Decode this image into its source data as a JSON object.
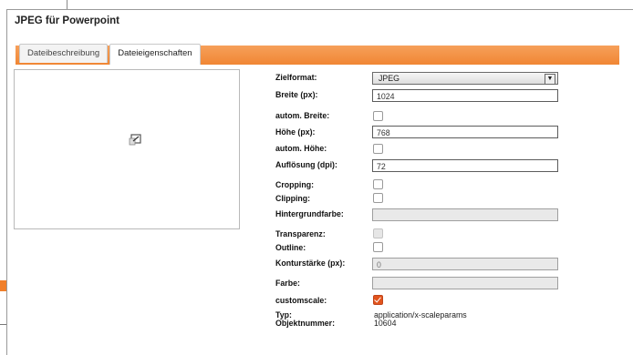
{
  "dialog": {
    "title": "JPEG für Powerpoint",
    "tabs": [
      {
        "label": "Dateibeschreibung",
        "active": false
      },
      {
        "label": "Dateieigenschaften",
        "active": true
      }
    ]
  },
  "preview": {
    "icon": "image-icon"
  },
  "form": {
    "zielformat": {
      "label": "Zielformat:",
      "value": "JPEG"
    },
    "breite": {
      "label": "Breite (px):",
      "value": "1024"
    },
    "autom_breite": {
      "label": "autom. Breite:",
      "checked": false
    },
    "hoehe": {
      "label": "Höhe (px):",
      "value": "768"
    },
    "autom_hoehe": {
      "label": "autom. Höhe:",
      "checked": false
    },
    "aufloesung": {
      "label": "Auflösung (dpi):",
      "value": "72"
    },
    "cropping": {
      "label": "Cropping:",
      "checked": false
    },
    "clipping": {
      "label": "Clipping:",
      "checked": false
    },
    "hintergrundfarbe": {
      "label": "Hintergrundfarbe:",
      "value": ""
    },
    "transparenz": {
      "label": "Transparenz:",
      "checked": false,
      "disabled": true
    },
    "outline": {
      "label": "Outline:",
      "checked": false
    },
    "konturstaerke": {
      "label": "Konturstärke (px):",
      "value": "0"
    },
    "farbe": {
      "label": "Farbe:",
      "value": ""
    },
    "customscale": {
      "label": "customscale:",
      "checked": true
    },
    "typ": {
      "label": "Typ:",
      "value": "application/x-scaleparams"
    },
    "objektnummer": {
      "label": "Objektnummer:",
      "value": "10604"
    }
  },
  "colors": {
    "accent": "#ee7b24",
    "checkbox_checked": "#e2541d"
  }
}
